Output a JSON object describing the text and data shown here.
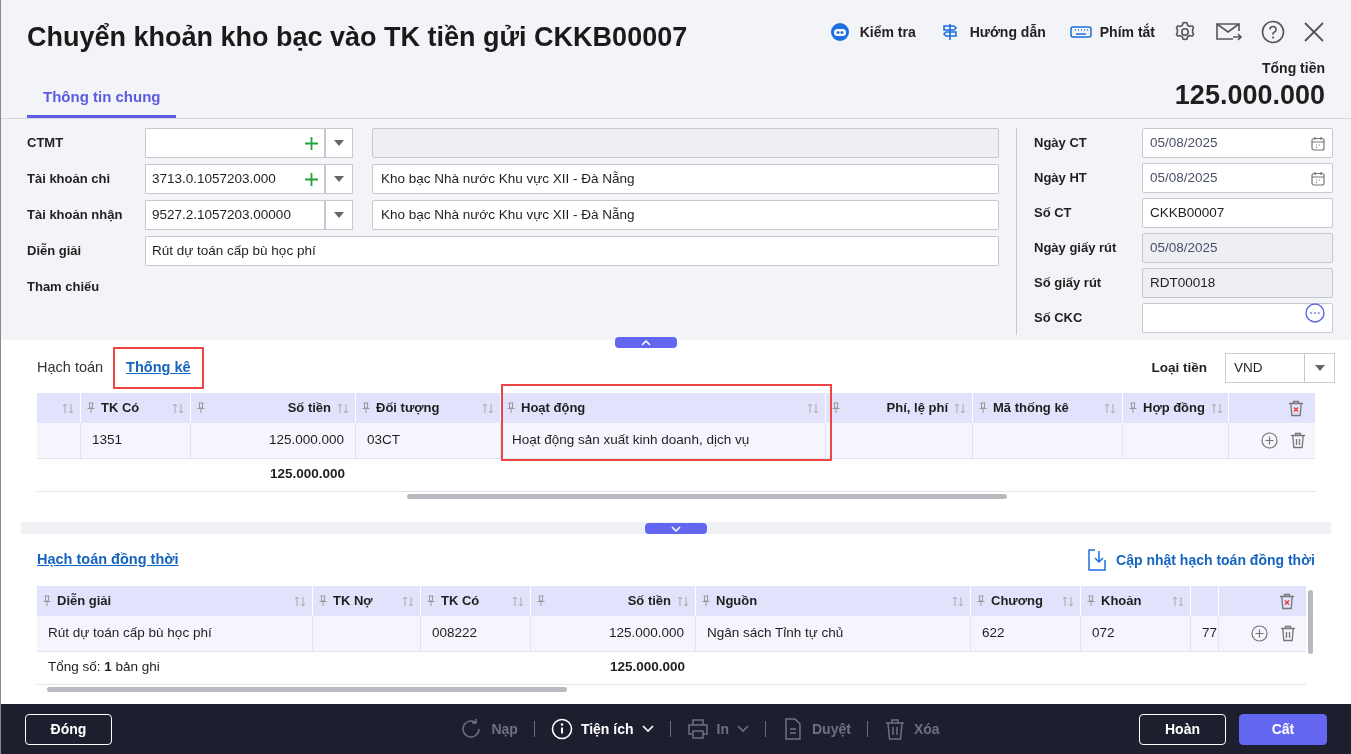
{
  "window": {
    "title": "Chuyển khoản kho bạc vào TK tiền gửi CKKB00007"
  },
  "toolbar": [
    {
      "kind": "check",
      "label": "Kiểm tra"
    },
    {
      "kind": "guide",
      "label": "Hướng dẫn"
    },
    {
      "kind": "shortcut",
      "label": "Phím tắt"
    }
  ],
  "tabs": [
    {
      "label": "Thông tin chung",
      "selected": true
    }
  ],
  "total": {
    "label": "Tổng tiền",
    "value": "125.000.000"
  },
  "form_left": [
    {
      "kind": "combo",
      "label": "CTMT",
      "add": true,
      "detail": {
        "disabled": true
      }
    },
    {
      "kind": "combo",
      "label": "Tài khoản chi",
      "value": "3713.0.1057203.000",
      "add": true,
      "detail": {
        "value": "Kho bạc Nhà nước Khu vực XII - Đà Nẵng",
        "disabled": false
      }
    },
    {
      "kind": "combo",
      "label": "Tài khoản nhận",
      "value": "9527.2.1057203.00000",
      "add": false,
      "detail": {
        "value": "Kho bạc Nhà nước Khu vực XII - Đà Nẵng",
        "disabled": false
      }
    },
    {
      "kind": "text",
      "label": "Diễn giải",
      "value": "Rút dự toán cấp bù học phí"
    },
    {
      "kind": "label",
      "label": "Tham chiếu"
    }
  ],
  "form_right": [
    {
      "kind": "date",
      "label": "Ngày CT",
      "value": "05/08/2025",
      "disabled": false
    },
    {
      "kind": "date",
      "label": "Ngày HT",
      "value": "05/08/2025",
      "disabled": false
    },
    {
      "kind": "text",
      "label": "Số CT",
      "value": "CKKB00007",
      "disabled": false
    },
    {
      "kind": "datetext",
      "label": "Ngày giấy rút",
      "value": "05/08/2025",
      "disabled": true
    },
    {
      "kind": "text",
      "label": "Số giấy rút",
      "value": "RDT00018",
      "disabled": true
    },
    {
      "kind": "lookup",
      "label": "Số CKC",
      "disabled": false
    }
  ],
  "detail_tabs": [
    {
      "label": "Hạch toán",
      "selected": false,
      "highlighted": false
    },
    {
      "label": "Thống kê",
      "selected": true,
      "highlighted": true
    }
  ],
  "currency": {
    "label": "Loại tiền",
    "value": "VND"
  },
  "grid": {
    "columns": [
      {
        "highlighted": false
      },
      {
        "label": "TK Có",
        "highlighted": false
      },
      {
        "label": "Số tiền",
        "highlighted": false
      },
      {
        "label": "Đối tượng",
        "highlighted": false
      },
      {
        "label": "Hoạt động",
        "highlighted": true
      },
      {
        "label": "Phí, lệ phí",
        "highlighted": false
      },
      {
        "label": "Mã thống kê",
        "highlighted": false
      },
      {
        "label": "Hợp đồng",
        "highlighted": false
      }
    ],
    "rows": [
      {
        "tk_co": "1351",
        "so_tien": "125.000.000",
        "doi_tuong": "03CT",
        "hoat_dong": "Hoạt động sản xuất kinh doanh, dịch vụ"
      }
    ],
    "footer": {
      "so_tien": "125.000.000"
    }
  },
  "concurrent": {
    "link": "Hạch toán đồng thời",
    "update_button": "Cập nhật hạch toán đồng thời",
    "columns": [
      {
        "label": "Diễn giải",
        "highlighted": false
      },
      {
        "label": "TK Nợ",
        "highlighted": false
      },
      {
        "label": "TK Có",
        "highlighted": false
      },
      {
        "label": "Số tiền",
        "highlighted": false
      },
      {
        "label": "Nguồn",
        "highlighted": false
      },
      {
        "label": "Chương",
        "highlighted": false
      },
      {
        "label": "Khoản",
        "highlighted": false
      },
      {
        "highlighted": false
      }
    ],
    "rows": [
      {
        "dien_giai": "Rút dự toán cấp bù học phí",
        "tk_co": "008222",
        "so_tien": "125.000.000",
        "nguon": "Ngân sách Tỉnh tự chủ",
        "chuong": "622",
        "khoan": "072",
        "column_8": "77"
      }
    ],
    "footer": {
      "dien_giai": "Tổng số: **1** bản ghi",
      "so_tien": "125.000.000"
    }
  },
  "bottom_left": [
    {
      "kind": "outline",
      "label": "Đóng"
    }
  ],
  "bottom_center": [
    {
      "kind": "reload",
      "label": "Nạp",
      "disabled": true,
      "dropdown": false
    },
    {
      "kind": "info",
      "label": "Tiện ích",
      "disabled": false,
      "dropdown": true
    },
    {
      "kind": "print",
      "label": "In",
      "disabled": true,
      "dropdown": true
    },
    {
      "kind": "approve",
      "label": "Duyệt",
      "disabled": true,
      "dropdown": false
    },
    {
      "kind": "delete",
      "label": "Xóa",
      "disabled": true,
      "dropdown": false
    }
  ],
  "bottom_right": [
    {
      "kind": "outline",
      "label": "Hoàn"
    },
    {
      "kind": "primary",
      "label": "Cất"
    }
  ]
}
